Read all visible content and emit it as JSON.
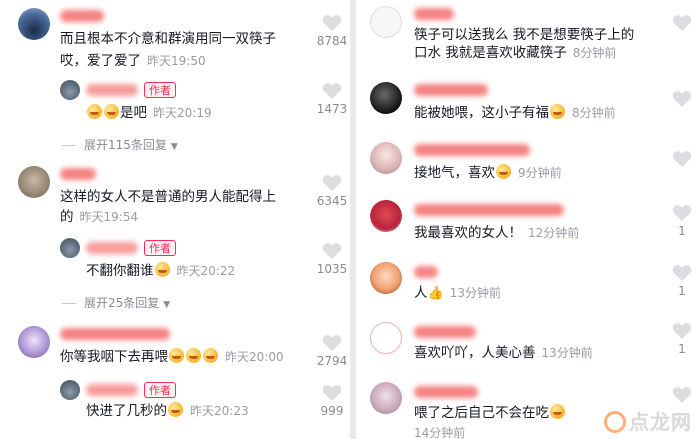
{
  "left_panel": {
    "comments": [
      {
        "text_line1": "而且根本不介意和群演用同一双筷子",
        "text_line2": "哎，爱了爱了",
        "time": "昨天19:50",
        "likes": "8784",
        "author_tag": "作者",
        "reply": {
          "text": "是吧",
          "time": "昨天20:19",
          "likes": "1473"
        },
        "expand": "展开115条回复"
      },
      {
        "text_line1": "这样的女人不是普通的男人能配得上",
        "text_line2": "的",
        "time": "昨天19:54",
        "likes": "6345",
        "author_tag": "作者",
        "reply": {
          "text": "不翻你翻谁",
          "time": "昨天20:22",
          "likes": "1035"
        },
        "expand": "展开25条回复"
      },
      {
        "text_line1": "你等我咽下去再喂",
        "time": "昨天20:00",
        "likes": "2794",
        "author_tag": "作者",
        "reply": {
          "text": "快进了几秒的",
          "time": "昨天20:23",
          "likes": "999"
        }
      }
    ]
  },
  "right_panel": {
    "comments": [
      {
        "text_line1": "筷子可以送我么 我不是想要筷子上的",
        "text_line2": "口水 我就是喜欢收藏筷子",
        "time": "8分钟前"
      },
      {
        "text_line1": "能被她喂，这小子有福",
        "time": "8分钟前"
      },
      {
        "text_line1": "接地气，喜欢",
        "time": "9分钟前"
      },
      {
        "text_line1": "我最喜欢的女人！",
        "time": "12分钟前",
        "likes": "1"
      },
      {
        "text_line1": "人",
        "time": "13分钟前",
        "likes": "1"
      },
      {
        "text_line1": "喜欢吖吖，人美心善",
        "time": "13分钟前",
        "likes": "1"
      },
      {
        "text_line1": "喂了之后自己不会在吃",
        "time": "14分钟前"
      }
    ]
  },
  "watermark": "点龙网",
  "colors": {
    "accent": "#fe2c55",
    "name_blur": "#f36b6b",
    "meta": "#9a9ca3"
  }
}
